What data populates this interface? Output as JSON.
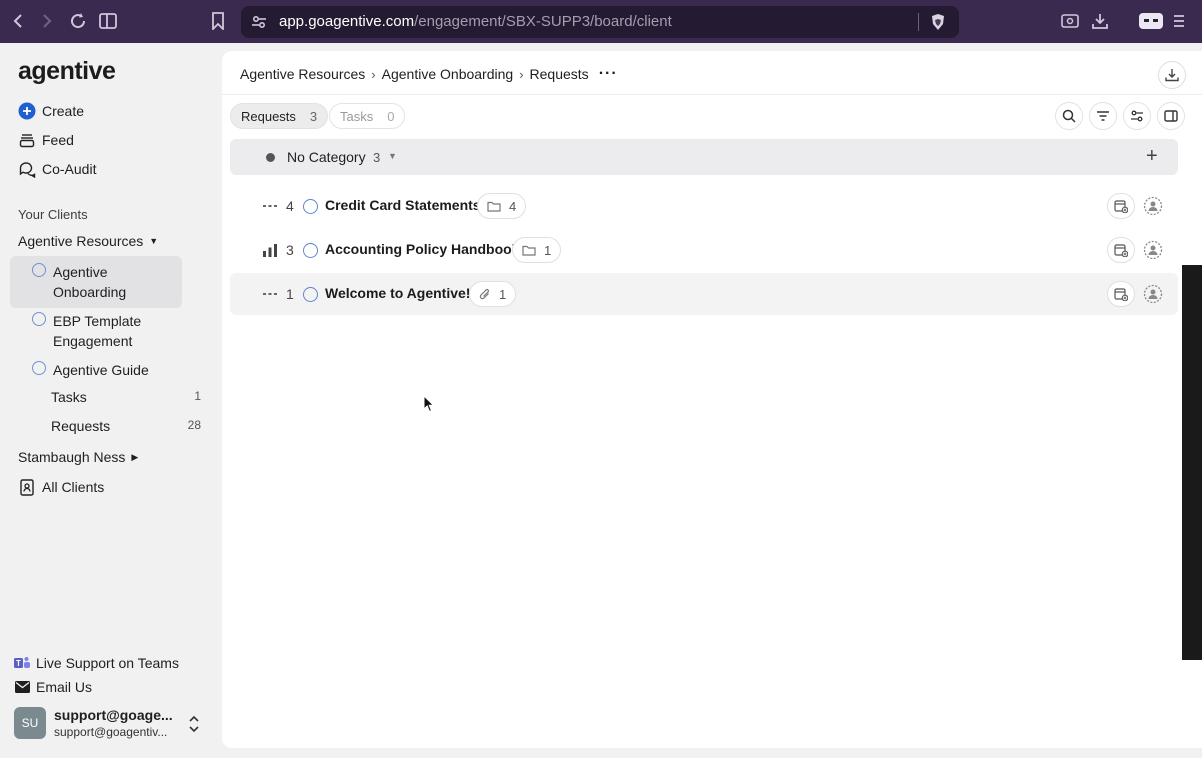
{
  "browser": {
    "url_host": "app.goagentive.com",
    "url_path": "/engagement/SBX-SUPP3/board/client"
  },
  "sidebar": {
    "logo": "agentive",
    "items": [
      {
        "label": "Create",
        "icon": "plus-circle-icon"
      },
      {
        "label": "Feed",
        "icon": "stack-icon"
      },
      {
        "label": "Co-Audit",
        "icon": "chat-bubbles-icon"
      }
    ],
    "section_label": "Your Clients",
    "client_groups": [
      {
        "label": "Agentive Resources",
        "expanded": true
      },
      {
        "label": "Stambaugh Ness",
        "expanded": false
      }
    ],
    "engagements": [
      {
        "label": "Agentive Onboarding",
        "active": true
      },
      {
        "label": "EBP Template Engagement",
        "active": false
      },
      {
        "label": "Agentive Guide",
        "active": false
      }
    ],
    "sub_items": [
      {
        "label": "Tasks",
        "count": "1"
      },
      {
        "label": "Requests",
        "count": "28"
      }
    ],
    "all_clients": "All Clients",
    "bottom": [
      {
        "label": "Live Support on Teams",
        "icon": "teams-icon"
      },
      {
        "label": "Email Us",
        "icon": "envelope-icon"
      }
    ],
    "user": {
      "initials": "SU",
      "name": "support@goage...",
      "email": "support@goagentiv..."
    }
  },
  "main": {
    "breadcrumbs": [
      "Agentive Resources",
      "Agentive Onboarding",
      "Requests"
    ],
    "tabs": [
      {
        "label": "Requests",
        "count": "3",
        "active": true
      },
      {
        "label": "Tasks",
        "count": "0",
        "active": false
      }
    ],
    "category": {
      "label": "No Category",
      "count": "3"
    },
    "rows": [
      {
        "num": "4",
        "title": "Credit Card Statements",
        "chip_icon": "folder-icon",
        "chip_count": "4",
        "priority": "none"
      },
      {
        "num": "3",
        "title": "Accounting Policy Handbook",
        "chip_icon": "folder-icon",
        "chip_count": "1",
        "priority": "medium"
      },
      {
        "num": "1",
        "title": "Welcome to Agentive!",
        "chip_icon": "paperclip-icon",
        "chip_count": "1",
        "priority": "none"
      }
    ]
  },
  "colors": {
    "chrome": "#3b2a50",
    "accent": "#1f5fcf",
    "ring": "#5e85cf"
  }
}
